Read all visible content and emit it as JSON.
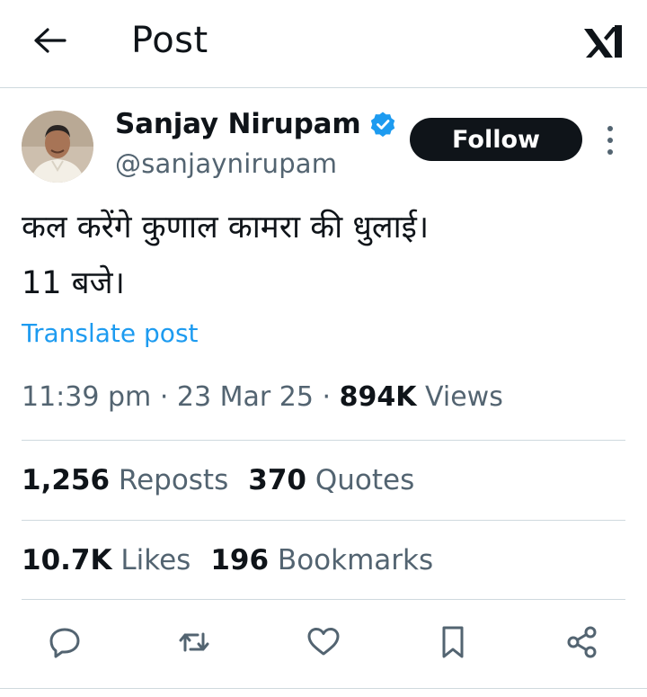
{
  "header": {
    "title": "Post",
    "back_icon": "arrow-left-icon",
    "logo_icon": "x-logo-icon"
  },
  "author": {
    "name": "Sanjay Nirupam",
    "handle": "@sanjaynirupam",
    "verified_icon": "verified-badge-icon",
    "follow_label": "Follow"
  },
  "tweet": {
    "lines": [
      "कल करेंगे कुणाल कामरा की धुलाई।",
      "11 बजे।"
    ],
    "translate_label": "Translate post"
  },
  "meta": {
    "time": "11:39 pm",
    "dot1": "·",
    "date": "23 Mar 25",
    "dot2": "·",
    "views_count": "894K",
    "views_label": "Views"
  },
  "stats": {
    "reposts_count": "1,256",
    "reposts_label": "Reposts",
    "quotes_count": "370",
    "quotes_label": "Quotes",
    "likes_count": "10.7K",
    "likes_label": "Likes",
    "bookmarks_count": "196",
    "bookmarks_label": "Bookmarks"
  },
  "actions": [
    "reply-icon",
    "repost-icon",
    "like-icon",
    "bookmark-icon",
    "share-icon"
  ],
  "colors": {
    "text": "#0f1419",
    "secondary": "#536471",
    "link": "#1d9bf0",
    "verified": "#1d9bf0",
    "divider": "#cfd9de",
    "follow_bg": "#0f1419"
  }
}
